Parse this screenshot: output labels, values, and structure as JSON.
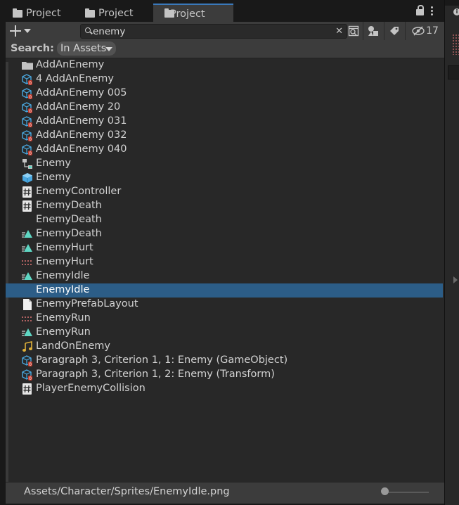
{
  "tabs": [
    {
      "label": "Project",
      "active": false
    },
    {
      "label": "Project",
      "active": false
    },
    {
      "label": "Project",
      "active": true
    }
  ],
  "toolbar": {
    "search_value": "enemy",
    "hidden_count": "17"
  },
  "search": {
    "label": "Search:",
    "scope": "In Assets"
  },
  "items": [
    {
      "name": "AddAnEnemy",
      "icon": "folder-icon"
    },
    {
      "name": "4 AddAnEnemy",
      "icon": "prefab-variant-icon"
    },
    {
      "name": "AddAnEnemy 005",
      "icon": "prefab-variant-icon"
    },
    {
      "name": "AddAnEnemy 20",
      "icon": "prefab-variant-icon"
    },
    {
      "name": "AddAnEnemy 031",
      "icon": "prefab-variant-icon"
    },
    {
      "name": "AddAnEnemy 032",
      "icon": "prefab-variant-icon"
    },
    {
      "name": "AddAnEnemy 040",
      "icon": "prefab-variant-icon"
    },
    {
      "name": "Enemy",
      "icon": "animator-controller-icon"
    },
    {
      "name": "Enemy",
      "icon": "prefab-icon"
    },
    {
      "name": "EnemyController",
      "icon": "script-icon"
    },
    {
      "name": "EnemyDeath",
      "icon": "script-icon"
    },
    {
      "name": "EnemyDeath",
      "icon": "none"
    },
    {
      "name": "EnemyDeath",
      "icon": "animation-clip-icon"
    },
    {
      "name": "EnemyHurt",
      "icon": "animation-clip-icon"
    },
    {
      "name": "EnemyHurt",
      "icon": "sprite-sheet-icon"
    },
    {
      "name": "EnemyIdle",
      "icon": "animation-clip-icon"
    },
    {
      "name": "EnemyIdle",
      "icon": "none",
      "selected": true
    },
    {
      "name": "EnemyPrefabLayout",
      "icon": "document-icon"
    },
    {
      "name": "EnemyRun",
      "icon": "sprite-sheet-icon"
    },
    {
      "name": "EnemyRun",
      "icon": "animation-clip-icon"
    },
    {
      "name": "LandOnEnemy",
      "icon": "audio-clip-icon"
    },
    {
      "name": "Paragraph 3, Criterion 1, 1: Enemy (GameObject)",
      "icon": "prefab-variant-icon"
    },
    {
      "name": "Paragraph 3, Criterion 1, 2: Enemy (Transform)",
      "icon": "prefab-variant-icon"
    },
    {
      "name": "PlayerEnemyCollision",
      "icon": "script-icon"
    }
  ],
  "footer": {
    "path": "Assets/Character/Sprites/EnemyIdle.png"
  },
  "colors": {
    "selection": "#2c5d87",
    "tab_accent": "#3a79bb",
    "prefab_blue": "#4aa8e0",
    "anim_teal": "#5fd6c3",
    "audio_gold": "#e0b13a"
  }
}
